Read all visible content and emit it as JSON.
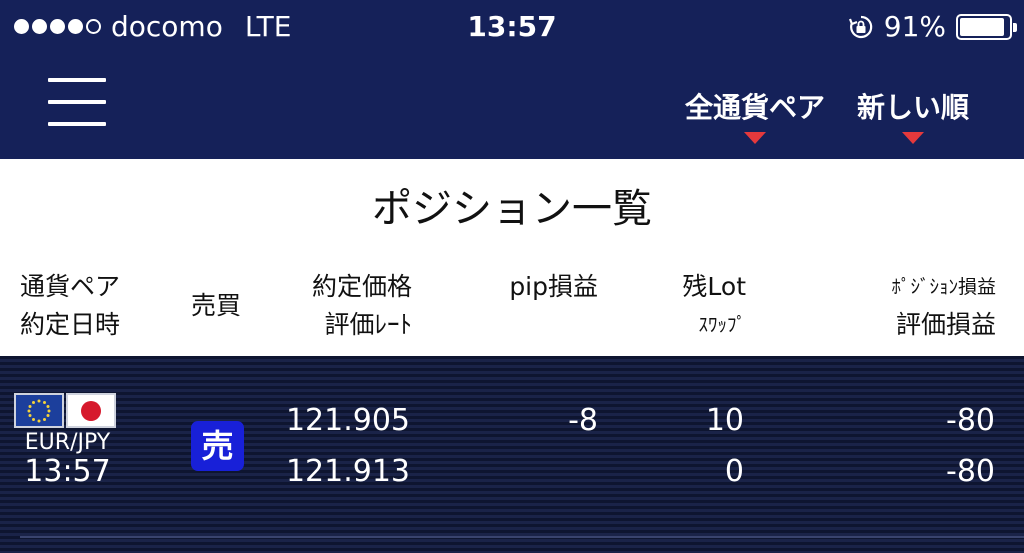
{
  "status_bar": {
    "carrier": "docomo",
    "network": "LTE",
    "time": "13:57",
    "battery": "91%",
    "battery_level": 0.91,
    "signal_bars_filled": 4,
    "signal_bars_total": 5
  },
  "nav": {
    "filter_pair": "全通貨ペア",
    "sort_order": "新しい順"
  },
  "page_title": "ポジション一覧",
  "table_header": {
    "pair": "通貨ペア",
    "contract_datetime": "約定日時",
    "side": "売買",
    "contract_price": "約定価格",
    "eval_rate": "評価ﾚｰﾄ",
    "pip_pl": "pip損益",
    "remaining_lot": "残Lot",
    "swap": "ｽﾜｯﾌﾟ",
    "position_pl": "ﾎﾟｼﾞｼｮﾝ損益",
    "eval_pl": "評価損益"
  },
  "positions": [
    {
      "pair": "EUR/JPY",
      "time": "13:57",
      "side": "売",
      "contract_price": "121.905",
      "eval_rate": "121.913",
      "pip_pl": "-8",
      "lot": "10",
      "swap": "0",
      "position_pl": "-80",
      "eval_pl": "-80"
    }
  ],
  "colors": {
    "header_bg": "#152159",
    "accent_caret": "#e5393c",
    "sell_badge": "#1820d8",
    "data_bg": "#0e1530"
  },
  "icons": [
    "hamburger-menu-icon",
    "caret-down-icon",
    "rotation-lock-icon",
    "battery-icon",
    "eu-flag-icon",
    "japan-flag-icon"
  ]
}
